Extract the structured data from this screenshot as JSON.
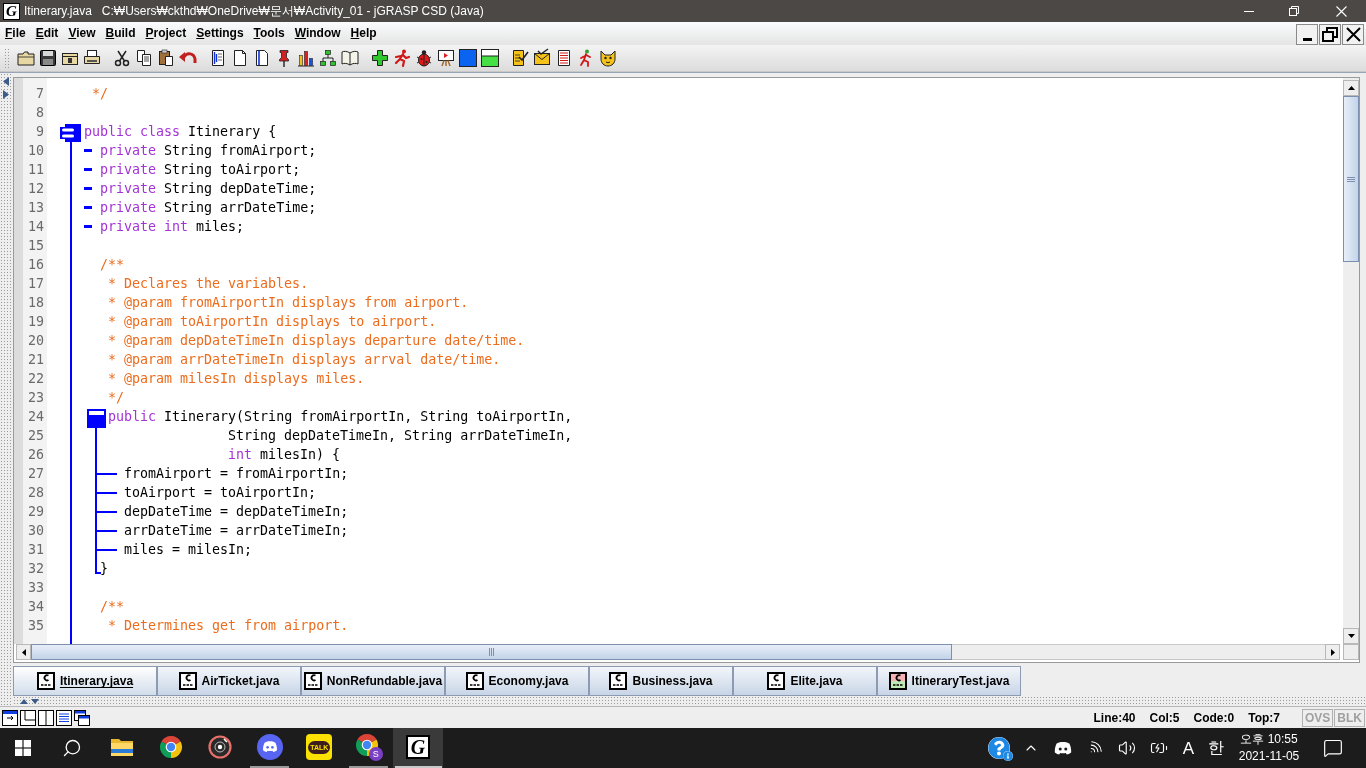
{
  "window": {
    "icon_letter": "G",
    "title": "Itinerary.java   C:₩Users₩ckthd₩OneDrive₩문서₩Activity_01 - jGRASP CSD (Java)"
  },
  "menu": [
    "File",
    "Edit",
    "View",
    "Build",
    "Project",
    "Settings",
    "Tools",
    "Window",
    "Help"
  ],
  "editor": {
    "lines": [
      {
        "number": "7",
        "kind": "file-comment",
        "tokens": [
          {
            "kind": "comment",
            "text": "*/"
          }
        ]
      },
      {
        "number": "8",
        "kind": "blank"
      },
      {
        "number": "9",
        "kind": "class-header",
        "tokens": [
          {
            "kind": "keyword",
            "text": "public class"
          },
          {
            "kind": "plain",
            "text": " Itinerary {"
          }
        ]
      },
      {
        "number": "10",
        "kind": "field",
        "tokens": [
          {
            "kind": "keyword",
            "text": "private"
          },
          {
            "kind": "plain",
            "text": " String fromAirport;"
          }
        ]
      },
      {
        "number": "11",
        "kind": "field",
        "tokens": [
          {
            "kind": "keyword",
            "text": "private"
          },
          {
            "kind": "plain",
            "text": " String toAirport;"
          }
        ]
      },
      {
        "number": "12",
        "kind": "field",
        "tokens": [
          {
            "kind": "keyword",
            "text": "private"
          },
          {
            "kind": "plain",
            "text": " String depDateTime;"
          }
        ]
      },
      {
        "number": "13",
        "kind": "field",
        "tokens": [
          {
            "kind": "keyword",
            "text": "private"
          },
          {
            "kind": "plain",
            "text": " String arrDateTime;"
          }
        ]
      },
      {
        "number": "14",
        "kind": "field",
        "tokens": [
          {
            "kind": "keyword",
            "text": "private int"
          },
          {
            "kind": "plain",
            "text": " miles;"
          }
        ]
      },
      {
        "number": "15",
        "kind": "blank"
      },
      {
        "number": "16",
        "kind": "javadoc-start",
        "tokens": [
          {
            "kind": "comment",
            "text": "/**"
          }
        ]
      },
      {
        "number": "17",
        "kind": "javadoc",
        "tokens": [
          {
            "kind": "comment",
            "text": "* Declares the variables."
          }
        ]
      },
      {
        "number": "18",
        "kind": "javadoc",
        "tokens": [
          {
            "kind": "comment",
            "text": "* @param fromAirportIn displays from airport."
          }
        ]
      },
      {
        "number": "19",
        "kind": "javadoc",
        "tokens": [
          {
            "kind": "comment",
            "text": "* @param toAirportIn displays to airport."
          }
        ]
      },
      {
        "number": "20",
        "kind": "javadoc",
        "tokens": [
          {
            "kind": "comment",
            "text": "* @param depDateTimeIn displays departure date/time."
          }
        ]
      },
      {
        "number": "21",
        "kind": "javadoc",
        "tokens": [
          {
            "kind": "comment",
            "text": "* @param arrDateTimeIn displays arrval date/time."
          }
        ]
      },
      {
        "number": "22",
        "kind": "javadoc",
        "tokens": [
          {
            "kind": "comment",
            "text": "* @param milesIn displays miles."
          }
        ]
      },
      {
        "number": "23",
        "kind": "javadoc",
        "tokens": [
          {
            "kind": "comment",
            "text": "*/"
          }
        ]
      },
      {
        "number": "24",
        "kind": "constructor-header",
        "tokens": [
          {
            "kind": "keyword",
            "text": "public"
          },
          {
            "kind": "plain",
            "text": " Itinerary(String fromAirportIn, String toAirportIn,"
          }
        ]
      },
      {
        "number": "25",
        "kind": "continuation",
        "tokens": [
          {
            "kind": "plain",
            "text": "String depDateTimeIn, String arrDateTimeIn,"
          }
        ]
      },
      {
        "number": "26",
        "kind": "continuation",
        "tokens": [
          {
            "kind": "keyword",
            "text": "int"
          },
          {
            "kind": "plain",
            "text": " milesIn) {"
          }
        ]
      },
      {
        "number": "27",
        "kind": "statement",
        "tokens": [
          {
            "kind": "plain",
            "text": "fromAirport = fromAirportIn;"
          }
        ]
      },
      {
        "number": "28",
        "kind": "statement",
        "tokens": [
          {
            "kind": "plain",
            "text": "toAirport = toAirportIn;"
          }
        ]
      },
      {
        "number": "29",
        "kind": "statement",
        "tokens": [
          {
            "kind": "plain",
            "text": "depDateTime = depDateTimeIn;"
          }
        ]
      },
      {
        "number": "30",
        "kind": "statement",
        "tokens": [
          {
            "kind": "plain",
            "text": "arrDateTime = arrDateTimeIn;"
          }
        ]
      },
      {
        "number": "31",
        "kind": "statement",
        "tokens": [
          {
            "kind": "plain",
            "text": "miles = milesIn;"
          }
        ]
      },
      {
        "number": "32",
        "kind": "block-end",
        "tokens": [
          {
            "kind": "plain",
            "text": "}"
          }
        ]
      },
      {
        "number": "33",
        "kind": "blank"
      },
      {
        "number": "34",
        "kind": "javadoc-start",
        "tokens": [
          {
            "kind": "comment",
            "text": "/**"
          }
        ]
      },
      {
        "number": "35",
        "kind": "javadoc",
        "tokens": [
          {
            "kind": "comment",
            "text": "* Determines get from airport."
          }
        ]
      }
    ]
  },
  "tabs": [
    {
      "label": "Itinerary.java",
      "kind": "source",
      "selected": true
    },
    {
      "label": "AirTicket.java",
      "kind": "source",
      "selected": false
    },
    {
      "label": "NonRefundable.java",
      "kind": "source",
      "selected": false
    },
    {
      "label": "Economy.java",
      "kind": "source",
      "selected": false
    },
    {
      "label": "Business.java",
      "kind": "source",
      "selected": false
    },
    {
      "label": "Elite.java",
      "kind": "source",
      "selected": false
    },
    {
      "label": "ItineraryTest.java",
      "kind": "test",
      "selected": false
    }
  ],
  "status_bar": {
    "fields": [
      "Line:40",
      "Col:5",
      "Code:0",
      "Top:7"
    ],
    "modes": [
      {
        "label": "OVS",
        "on": false
      },
      {
        "label": "BLK",
        "on": false
      }
    ]
  },
  "taskbar": {
    "apps": [
      {
        "kind": "folder",
        "running": false,
        "active": false
      },
      {
        "kind": "browser",
        "running": false,
        "active": false
      },
      {
        "kind": "disc",
        "running": false,
        "active": false
      },
      {
        "kind": "controller-face",
        "running": true,
        "active": false
      },
      {
        "kind": "talk",
        "label": "TALK",
        "running": false,
        "active": false
      },
      {
        "kind": "browser-profile",
        "badge": "S",
        "running": true,
        "active": false
      },
      {
        "kind": "letter-tile",
        "letter": "G",
        "running": true,
        "active": true
      }
    ],
    "ime": [
      "A",
      "한"
    ],
    "time": "오후 10:55",
    "date": "2021-11-05"
  }
}
